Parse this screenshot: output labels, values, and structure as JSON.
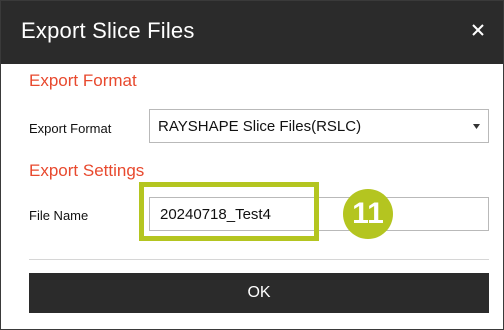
{
  "dialog": {
    "title": "Export Slice Files",
    "close_glyph": "×",
    "title_bar_color": "#2b2b2b"
  },
  "export_format": {
    "section_title": "Export Format",
    "label": "Export Format",
    "selected_value": "RAYSHAPE Slice Files(RSLC)"
  },
  "export_settings": {
    "section_title": "Export Settings",
    "file_name_label": "File Name",
    "file_name_value": "20240718_Test4"
  },
  "annotation": {
    "step_number": "11",
    "highlight_color": "#b4c520"
  },
  "footer": {
    "ok_label": "OK"
  },
  "colors": {
    "section_accent": "#e8492e",
    "dark": "#2b2b2b"
  },
  "icons": {
    "close": "close-icon",
    "dropdown": "chevron-down-icon"
  }
}
